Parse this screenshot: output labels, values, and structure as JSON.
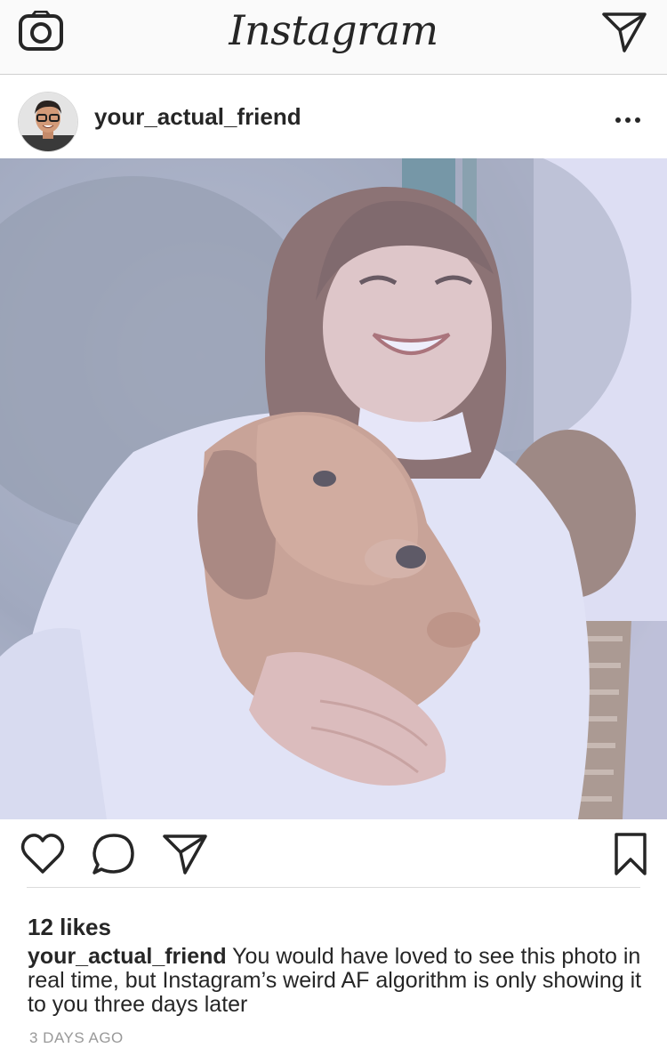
{
  "header": {
    "logo": "Instagram",
    "camera_icon": "camera-icon",
    "direct_icon": "paper-plane-icon"
  },
  "post": {
    "username": "your_actual_friend",
    "more_icon": "more-dots-icon",
    "photo_description_icon": "post-photo",
    "actions": {
      "like_icon": "heart-icon",
      "comment_icon": "comment-bubble-icon",
      "share_icon": "paper-plane-icon",
      "save_icon": "bookmark-icon"
    },
    "likes": "12 likes",
    "caption_user": "your_actual_friend",
    "caption_text": " You would have loved to see this photo in real time, but Instagram’s weird AF algorithm is only showing it to you three days later",
    "timestamp": "3 DAYS AGO"
  },
  "colors": {
    "text": "#262626",
    "muted": "#999999",
    "header_bg": "#fafafa",
    "photo_tint": "#c9cbf2"
  }
}
